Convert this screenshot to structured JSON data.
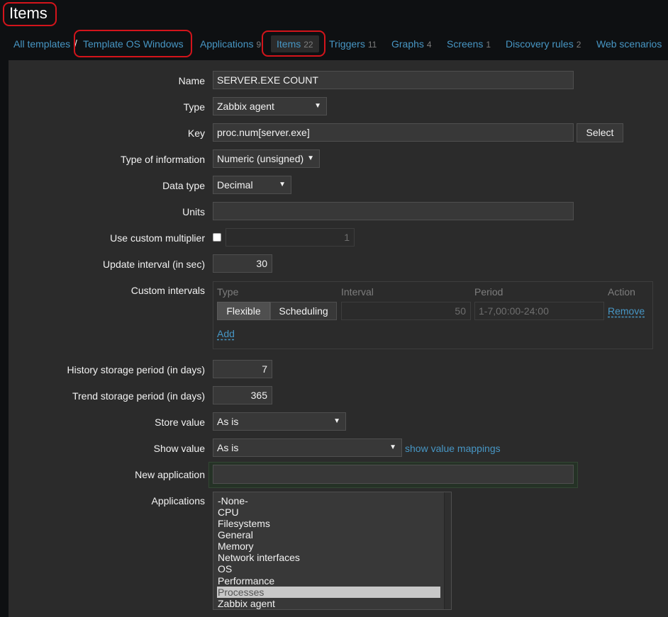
{
  "page": {
    "title": "Items"
  },
  "nav": {
    "all_templates": "All templates",
    "separator": "/",
    "template": "Template OS Windows",
    "tabs": [
      {
        "label": "Applications",
        "count": "9"
      },
      {
        "label": "Items",
        "count": "22"
      },
      {
        "label": "Triggers",
        "count": "11"
      },
      {
        "label": "Graphs",
        "count": "4"
      },
      {
        "label": "Screens",
        "count": "1"
      },
      {
        "label": "Discovery rules",
        "count": "2"
      },
      {
        "label": "Web scenarios",
        "count": ""
      }
    ]
  },
  "form": {
    "name": {
      "label": "Name",
      "value": "SERVER.EXE COUNT"
    },
    "type": {
      "label": "Type",
      "value": "Zabbix agent"
    },
    "key": {
      "label": "Key",
      "value": "proc.num[server.exe]",
      "button": "Select"
    },
    "type_of_information": {
      "label": "Type of information",
      "value": "Numeric (unsigned)"
    },
    "data_type": {
      "label": "Data type",
      "value": "Decimal"
    },
    "units": {
      "label": "Units",
      "value": ""
    },
    "custom_multiplier": {
      "label": "Use custom multiplier",
      "checked": false,
      "value": "1"
    },
    "update_interval": {
      "label": "Update interval (in sec)",
      "value": "30"
    },
    "custom_intervals": {
      "label": "Custom intervals",
      "headers": {
        "type": "Type",
        "interval": "Interval",
        "period": "Period",
        "action": "Action"
      },
      "type_options": {
        "flexible": "Flexible",
        "scheduling": "Scheduling"
      },
      "selected_type": "Flexible",
      "interval": "50",
      "period": "1-7,00:00-24:00",
      "remove": "Remove",
      "add": "Add"
    },
    "history": {
      "label": "History storage period (in days)",
      "value": "7"
    },
    "trends": {
      "label": "Trend storage period (in days)",
      "value": "365"
    },
    "store_value": {
      "label": "Store value",
      "value": "As is"
    },
    "show_value": {
      "label": "Show value",
      "value": "As is",
      "link": "show value mappings"
    },
    "new_application": {
      "label": "New application",
      "value": ""
    },
    "applications": {
      "label": "Applications",
      "options": [
        "-None-",
        "CPU",
        "Filesystems",
        "General",
        "Memory",
        "Network interfaces",
        "OS",
        "Performance",
        "Processes",
        "Zabbix agent"
      ],
      "selected": "Processes"
    }
  },
  "colors": {
    "background": "#0e1012",
    "panel": "#2b2b2b",
    "link": "#4796c4",
    "annotation": "#d3141b"
  }
}
